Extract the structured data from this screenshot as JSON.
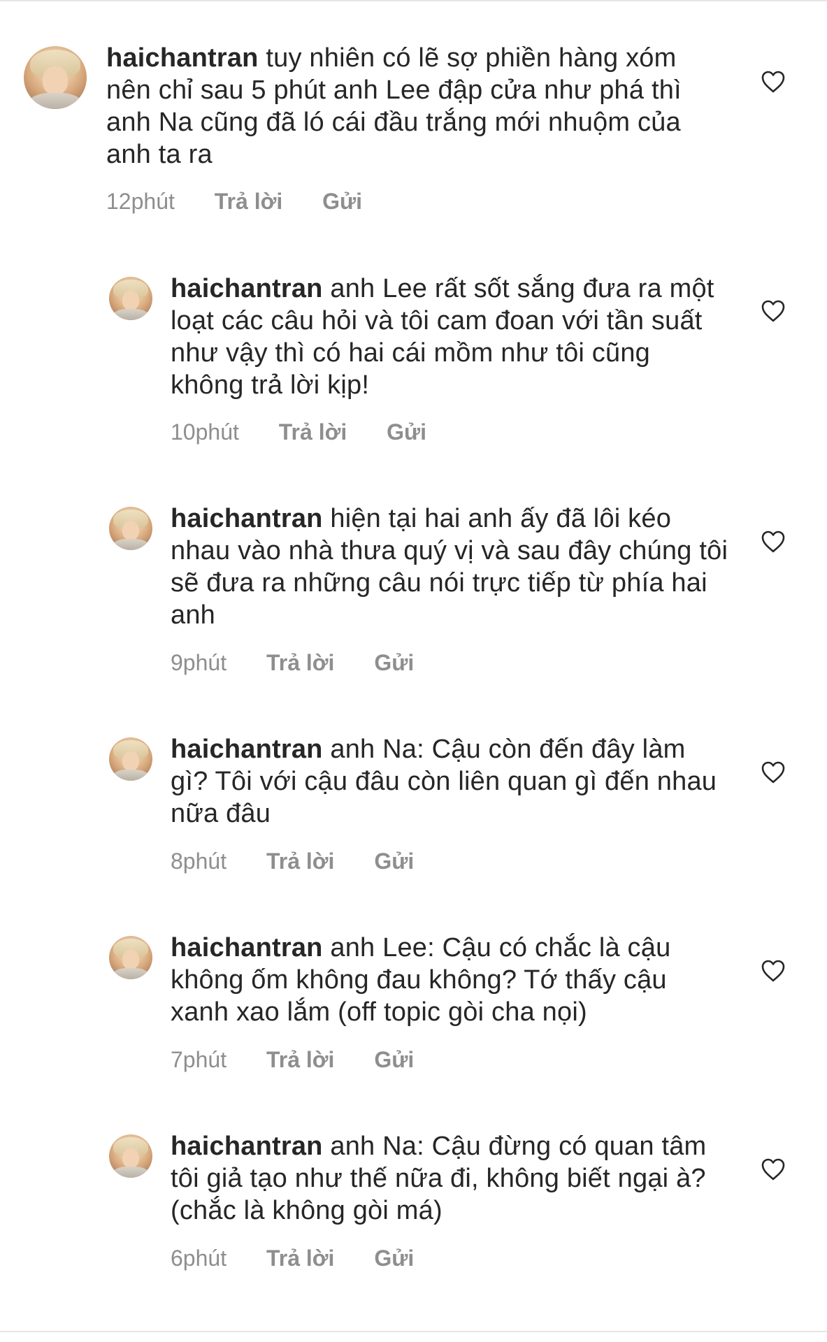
{
  "comments": [
    {
      "username": "haichantran",
      "text": "tuy nhiên có lẽ sợ phiền hàng xóm nên chỉ sau 5 phút anh Lee đập cửa như phá thì anh Na cũng đã ló cái đầu trắng mới nhuộm của anh ta ra",
      "time": "12phút",
      "reply_label": "Trả lời",
      "send_label": "Gửi"
    },
    {
      "username": "haichantran",
      "text": "anh Lee rất sốt sắng đưa ra một loạt các câu hỏi và tôi cam đoan với tần suất như vậy thì có hai cái mồm như tôi cũng không trả lời kịp!",
      "time": "10phút",
      "reply_label": "Trả lời",
      "send_label": "Gửi"
    },
    {
      "username": "haichantran",
      "text": "hiện tại hai anh ấy đã lôi kéo nhau vào nhà thưa quý vị và sau đây chúng tôi sẽ đưa ra những câu nói trực tiếp từ phía hai anh",
      "time": "9phút",
      "reply_label": "Trả lời",
      "send_label": "Gửi"
    },
    {
      "username": "haichantran",
      "text": "anh Na: Cậu còn đến đây làm gì? Tôi với cậu đâu còn liên quan gì đến nhau nữa đâu",
      "time": "8phút",
      "reply_label": "Trả lời",
      "send_label": "Gửi"
    },
    {
      "username": "haichantran",
      "text": "anh Lee: Cậu có chắc là cậu không ốm không đau không? Tớ thấy cậu xanh xao lắm (off topic gòi cha nọi)",
      "time": "7phút",
      "reply_label": "Trả lời",
      "send_label": "Gửi"
    },
    {
      "username": "haichantran",
      "text": "anh Na: Cậu đừng có quan tâm tôi giả tạo như thế nữa đi, không biết ngại à? (chắc là không gòi má)",
      "time": "6phút",
      "reply_label": "Trả lời",
      "send_label": "Gửi"
    }
  ],
  "icons": {
    "like": "heart-outline-icon",
    "avatar": "profile-photo"
  },
  "colors": {
    "text": "#262626",
    "meta": "#8e8e8e",
    "background": "#ffffff"
  }
}
